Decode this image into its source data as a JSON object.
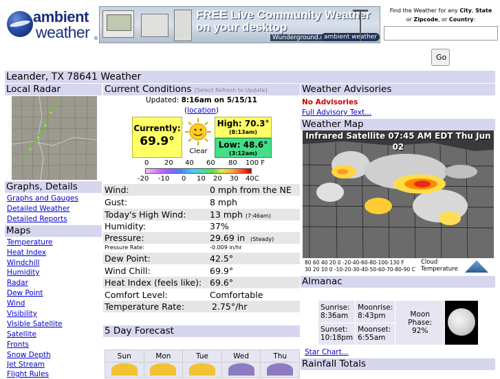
{
  "header": {
    "logo": {
      "line1": "ambient",
      "line2": "weather"
    },
    "banner": {
      "line1": "FREE Live Community Weather",
      "line2": "on your desktop",
      "partner1": "Wunderground.com",
      "partner2": "ambient weather"
    },
    "finder": {
      "line1_prefix": "Find the Weather for any ",
      "line1_b1": "City",
      "line1_sep": ", ",
      "line1_b2": "State",
      "line2_prefix": "or ",
      "line2_b1": "Zipcode",
      "line2_mid": ", or ",
      "line2_b2": "Country",
      "line2_suffix": ":",
      "input_value": "",
      "go_label": "Go"
    }
  },
  "page_title": "Leander, TX 78641 Weather",
  "left": {
    "radar_title": "Local Radar",
    "graphs_title": "Graphs, Details",
    "graphs_links": [
      "Graphs and Gauges",
      "Detailed Weather",
      "Detailed Reports"
    ],
    "maps_title": "Maps",
    "maps_links": [
      "Temperature",
      "Heat Index",
      "Windchill",
      "Humidity",
      "Radar",
      "Dew Point",
      "Wind",
      "Visibility",
      "Visible Satellite",
      "Satellite",
      "Fronts",
      "Snow Depth",
      "Jet Stream",
      "Flight Rules"
    ]
  },
  "current": {
    "title": "Current Conditions",
    "refresh_note": "[Select Refresh to Update]",
    "updated_label": "Updated:",
    "updated_value": "8:16am on 5/15/11",
    "location_open": "(",
    "location_link": "location",
    "location_close": ")",
    "currently_label": "Currently:",
    "currently_value": "69.9°",
    "condition": "Clear",
    "high_label": "High: 70.3°",
    "high_time": "(8:13am)",
    "low_label": "Low: 48.6°",
    "low_time": "(3:12am)",
    "scale_f": [
      "0",
      "20",
      "40",
      "60",
      "80",
      "100 F"
    ],
    "scale_c": [
      "-20",
      "-10",
      "0",
      "10",
      "20",
      "30",
      "40C"
    ],
    "rows": [
      {
        "k": "Wind:",
        "v": "0 mph from the NE"
      },
      {
        "k": "Gust:",
        "v": "8 mph"
      },
      {
        "k": "Today's High Wind:",
        "v": "13 mph",
        "v_small": "(7:46am)"
      },
      {
        "k": "Humidity:",
        "v": "37%"
      },
      {
        "k": "Pressure:",
        "v": "29.69 in",
        "v_small": "(Steady)"
      },
      {
        "k": "Pressure Rate:",
        "v": "-0.009 in/hr"
      },
      {
        "k": "Dew Point:",
        "v": "42.5°"
      },
      {
        "k": "Wind Chill:",
        "v": "69.9°"
      },
      {
        "k": "Heat Index (feels like):",
        "v": "69.6°"
      },
      {
        "k": "Comfort Level:",
        "v": "Comfortable"
      },
      {
        "k": "Temperature Rate:",
        "v": "2.75°/hr"
      }
    ]
  },
  "forecast": {
    "title": "5 Day Forecast",
    "days": [
      "Sun",
      "Mon",
      "Tue",
      "Wed",
      "Thu"
    ]
  },
  "right": {
    "advisories_title": "Weather Advisories",
    "no_advisories": "No Advisories",
    "full_advisory": "Full Advisory Text...",
    "map_title": "Weather Map",
    "map_header": "Infrared Satellite 07:45 AM EDT Thu Jun 02",
    "map_legend_nums": "80 60 40 20  0 -20-40-60-80-100-130 F",
    "map_legend_nums2": "30 20 10 0 -10-20-30-40-50-60-70-80-90 C",
    "map_legend_words": [
      "Cloud",
      "Temperature"
    ],
    "almanac_title": "Almanac",
    "sunrise_label": "Sunrise:",
    "sunrise": "8:36am",
    "sunset_label": "Sunset:",
    "sunset": "10:18pm",
    "moonrise_label": "Moonrise:",
    "moonrise": "8:43pm",
    "moonset_label": "Moonset:",
    "moonset": "6:55am",
    "moon_phase_label": "Moon Phase:",
    "moon_phase": "92%",
    "star_chart": "Star Chart...",
    "rain_title": "Rainfall Totals"
  }
}
